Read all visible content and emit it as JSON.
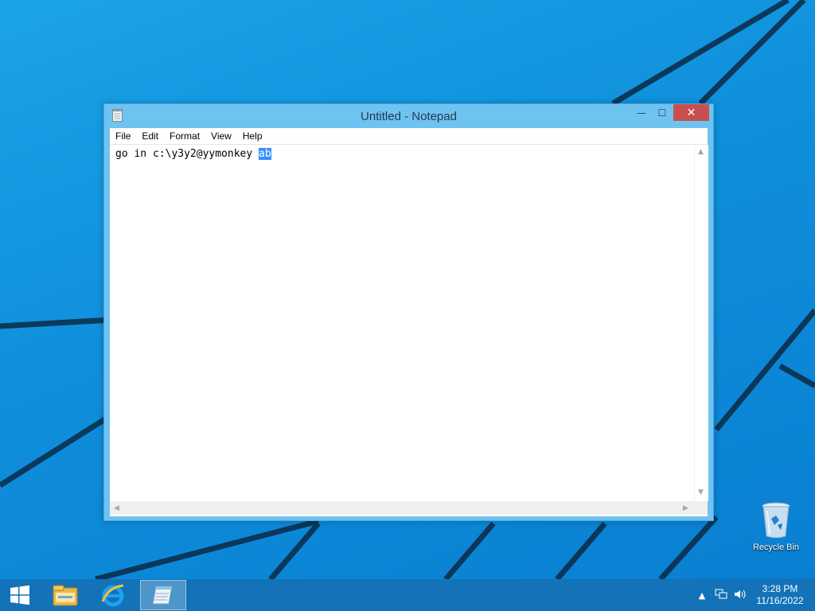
{
  "window": {
    "title": "Untitled - Notepad",
    "minimize_glyph": "—",
    "maximize_glyph": "☐",
    "close_glyph": "✕"
  },
  "menu": [
    {
      "label": "File"
    },
    {
      "label": "Edit"
    },
    {
      "label": "Format"
    },
    {
      "label": "View"
    },
    {
      "label": "Help"
    }
  ],
  "editor": {
    "text_before_selection": "go in c:\\y3y2@yymonkey ",
    "selected_text": "ab"
  },
  "desktop": {
    "recycle_bin_label": "Recycle Bin"
  },
  "taskbar": {
    "clock_time": "3:28 PM",
    "clock_date": "11/16/2022",
    "icons": [
      "windows-start-icon",
      "file-explorer-icon",
      "internet-explorer-icon",
      "notepad-icon"
    ],
    "tray_icons": [
      "show-hidden-icons-chevron",
      "network-icon",
      "volume-icon"
    ]
  },
  "colors": {
    "desktop_blue": "#1ba3e8",
    "window_frame": "#6fc3f0",
    "close_button": "#c7504f",
    "selection": "#3390ff",
    "taskbar": "#1372b8"
  }
}
